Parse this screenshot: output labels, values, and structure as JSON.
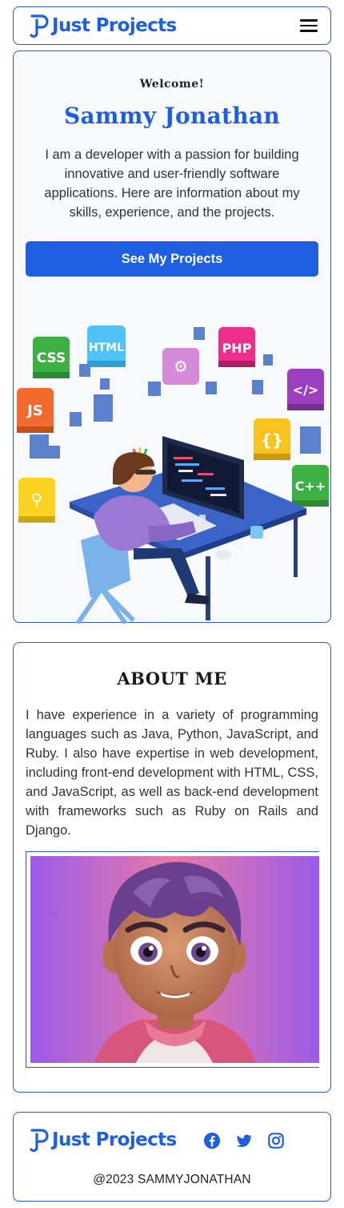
{
  "brand": {
    "name": "Just Projects",
    "color": "#1d5fe0",
    "logo_icon": "jp-logo-icon"
  },
  "header": {
    "menu_icon": "hamburger-menu-icon"
  },
  "hero": {
    "greeting": "Welcome!",
    "name": "Sammy Jonathan",
    "description": "I am a developer with a passion for building innovative and user-friendly software applications. Here are information about my skills, experience, and the projects.",
    "cta_label": "See My Projects",
    "illustration": "developer-at-desk-illustration",
    "illustration_badges": [
      "CSS",
      "HTML",
      "PHP",
      "JS",
      "{ }",
      "</>",
      "C++"
    ]
  },
  "about": {
    "title": "ABOUT ME",
    "text": "I have experience in a variety of programming languages such as Java, Python, JavaScript, and Ruby. I also have expertise in web development, including front-end development with HTML, CSS, and JavaScript, as well as back-end development with frameworks such as Ruby on Rails and Django.",
    "image": "cartoon-avatar-portrait"
  },
  "footer": {
    "social_icons": [
      "facebook-icon",
      "twitter-icon",
      "instagram-icon"
    ],
    "copyright": "@2023 SAMMYJONATHAN"
  }
}
